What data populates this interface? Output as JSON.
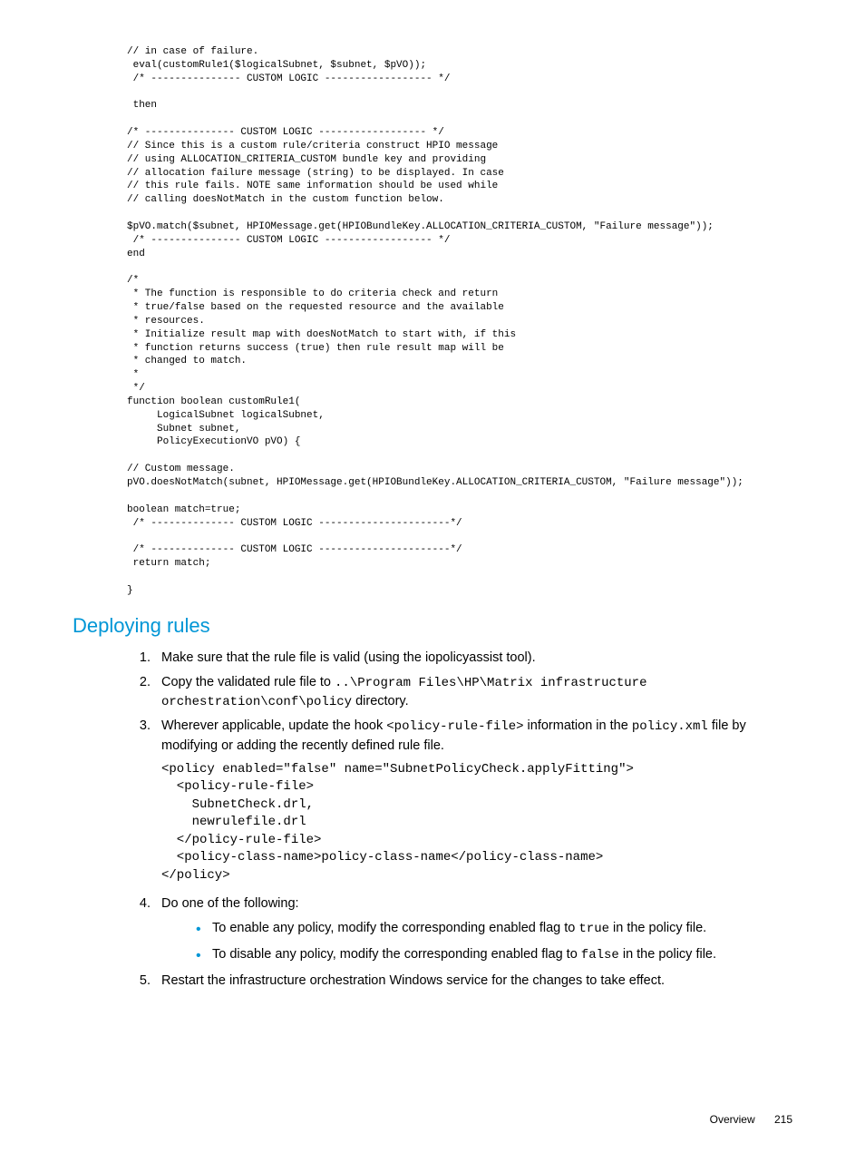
{
  "code_block": "// in case of failure.\n eval(customRule1($logicalSubnet, $subnet, $pVO));\n /* --------------- CUSTOM LOGIC ------------------ */\n\n then\n\n/* --------------- CUSTOM LOGIC ------------------ */\n// Since this is a custom rule/criteria construct HPIO message\n// using ALLOCATION_CRITERIA_CUSTOM bundle key and providing\n// allocation failure message (string) to be displayed. In case\n// this rule fails. NOTE same information should be used while\n// calling doesNotMatch in the custom function below.\n\n$pVO.match($subnet, HPIOMessage.get(HPIOBundleKey.ALLOCATION_CRITERIA_CUSTOM, \"Failure message\"));\n /* --------------- CUSTOM LOGIC ------------------ */\nend\n\n/*\n * The function is responsible to do criteria check and return\n * true/false based on the requested resource and the available\n * resources.\n * Initialize result map with doesNotMatch to start with, if this\n * function returns success (true) then rule result map will be\n * changed to match.\n *\n */\nfunction boolean customRule1(\n     LogicalSubnet logicalSubnet,\n     Subnet subnet,\n     PolicyExecutionVO pVO) {\n\n// Custom message.\npVO.doesNotMatch(subnet, HPIOMessage.get(HPIOBundleKey.ALLOCATION_CRITERIA_CUSTOM, \"Failure message\"));\n\nboolean match=true;\n /* -------------- CUSTOM LOGIC ----------------------*/\n\n /* -------------- CUSTOM LOGIC ----------------------*/\n return match;\n\n}",
  "heading": "Deploying rules",
  "list": {
    "item1": "Make sure that the rule file is valid (using the iopolicyassist tool).",
    "item2_a": "Copy the validated rule file to ",
    "item2_code": "..\\Program Files\\HP\\Matrix infrastructure orchestration\\conf\\policy",
    "item2_b": " directory.",
    "item3_a": "Wherever applicable, update the hook ",
    "item3_code": "<policy-rule-file>",
    "item3_b": " information in the ",
    "item3_code2": "policy.xml",
    "item3_c": " file by modifying or adding the recently defined rule file.",
    "item3_block": "<policy enabled=\"false\" name=\"SubnetPolicyCheck.applyFitting\">\n  <policy-rule-file>\n    SubnetCheck.drl,\n    newrulefile.drl\n  </policy-rule-file>\n  <policy-class-name>policy-class-name</policy-class-name>\n</policy>",
    "item4": "Do one of the following:",
    "item4_bullet1_a": "To enable any policy, modify the corresponding enabled flag to ",
    "item4_bullet1_code": "true",
    "item4_bullet1_b": " in the policy file.",
    "item4_bullet2_a": "To disable any policy, modify the corresponding enabled flag to ",
    "item4_bullet2_code": "false",
    "item4_bullet2_b": " in the policy file.",
    "item5": "Restart the infrastructure orchestration Windows service for the changes to take effect."
  },
  "footer": {
    "label": "Overview",
    "page": "215"
  }
}
